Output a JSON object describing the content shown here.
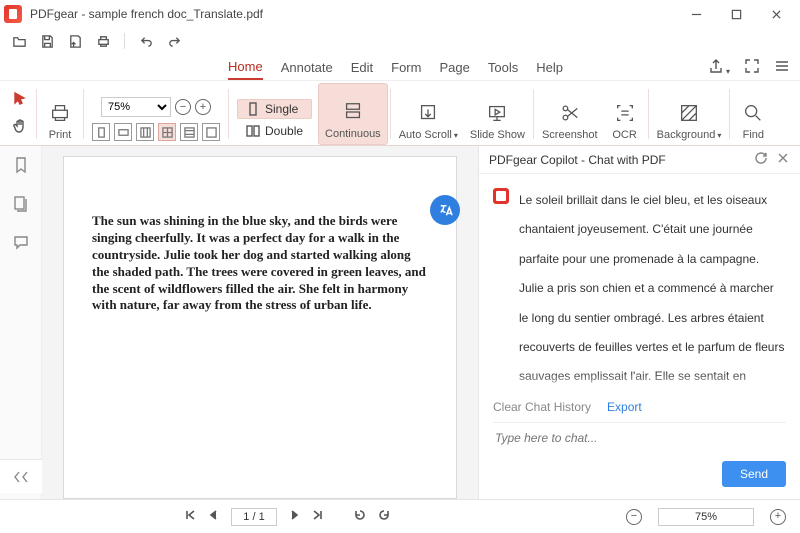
{
  "window": {
    "title": "PDFgear - sample french doc_Translate.pdf"
  },
  "tabs": {
    "home": "Home",
    "annotate": "Annotate",
    "edit": "Edit",
    "form": "Form",
    "page": "Page",
    "tools": "Tools",
    "help": "Help"
  },
  "ribbon": {
    "print": "Print",
    "zoom_value": "75%",
    "single": "Single",
    "double": "Double",
    "continuous": "Continuous",
    "autoscroll": "Auto Scroll",
    "slideshow": "Slide Show",
    "screenshot": "Screenshot",
    "ocr": "OCR",
    "background": "Background",
    "find": "Find"
  },
  "document": {
    "text": "The sun was shining in the blue sky, and the birds were singing cheerfully. It was a perfect day for a walk in the countryside. Julie took her dog and started walking along the shaded path. The trees were covered in green leaves, and the scent of wildflowers filled the air. She felt in harmony with nature, far away from the stress of urban life."
  },
  "copilot": {
    "title": "PDFgear Copilot - Chat with PDF",
    "message": "Le soleil brillait dans le ciel bleu, et les oiseaux chantaient joyeusement. C'était une journée parfaite pour une promenade à la campagne. Julie a pris son chien et a commencé à marcher le long du sentier ombragé. Les arbres étaient recouverts de feuilles vertes et le parfum de fleurs sauvages emplissait l'air. Elle se sentait en harmonie avec la nature, loin du stress de la vie urbaine.",
    "clear": "Clear Chat History",
    "export": "Export",
    "placeholder": "Type here to chat...",
    "send": "Send"
  },
  "nav": {
    "page": "1 / 1",
    "zoom": "75%"
  }
}
